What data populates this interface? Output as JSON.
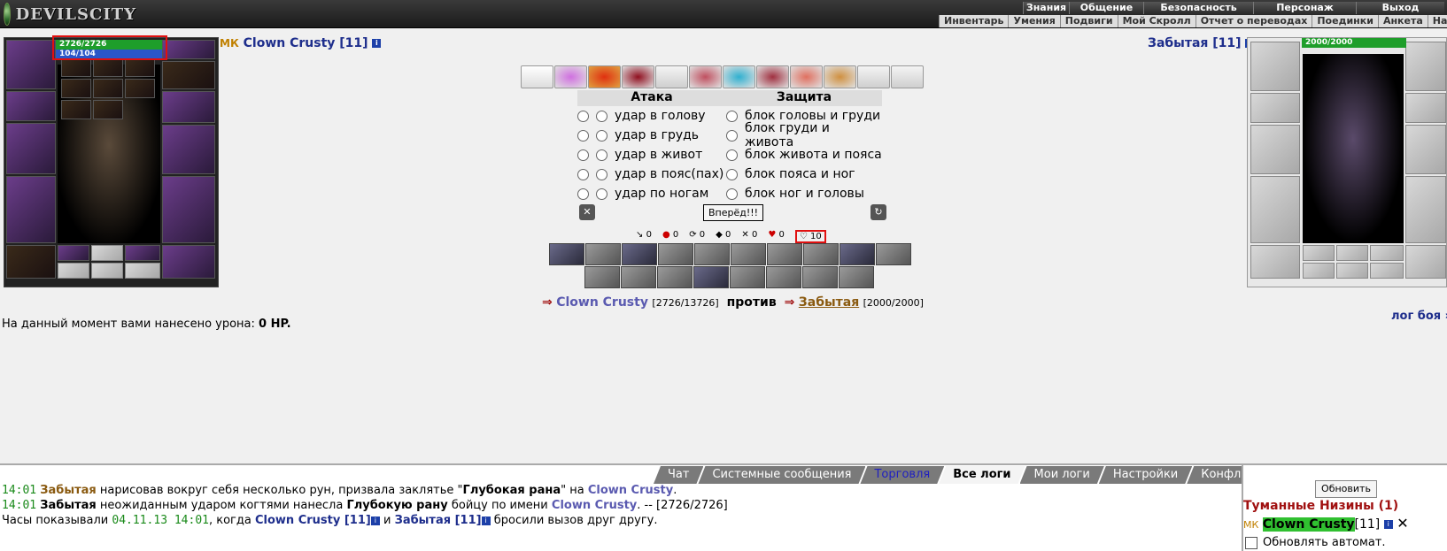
{
  "site": {
    "logo_text": "DEVILSCITY"
  },
  "main_menu": [
    "Знания",
    "Общение",
    "Безопасность",
    "Персонаж",
    "Выход"
  ],
  "sub_menu": [
    "Инвентарь",
    "Умения",
    "Подвиги",
    "Мой Скролл",
    "Отчет о переводах",
    "Поединки",
    "Анкета",
    "Настройки"
  ],
  "player": {
    "name": "Clown Crusty [11]",
    "hp": "2726/2726",
    "mana": "104/104",
    "clan_badge": "МК",
    "hp_fraction": 1.0,
    "mana_fraction": 1.0
  },
  "enemy": {
    "name": "Забытая [11]",
    "hp": "2000/2000",
    "hp_fraction": 1.0
  },
  "combat": {
    "attack_header": "Атака",
    "defense_header": "Защита",
    "attacks": [
      "удар в голову",
      "удар в грудь",
      "удар в живот",
      "удар в пояс(пах)",
      "удар по ногам"
    ],
    "blocks": [
      "блок головы и груди",
      "блок груди и живота",
      "блок живота и пояса",
      "блок пояса и ног",
      "блок ног и головы"
    ],
    "forward_button": "Вперёд!!!"
  },
  "counters": [
    "0",
    "0",
    "0",
    "0",
    "0",
    "0",
    "10"
  ],
  "versus": {
    "player_name": "Clown Crusty",
    "player_hp": "[2726/13726]",
    "vs_word": "против",
    "enemy_name": "Забытая",
    "enemy_hp": "[2000/2000]"
  },
  "damage_text": {
    "prefix": "На данный момент вами нанесено урона:",
    "value": "0 HP."
  },
  "battle_log_link": "лог боя »",
  "chat_tabs": [
    "Чат",
    "Системные сообщения",
    "Торговля",
    "Все логи",
    "Мои логи",
    "Настройки",
    "Конфликты"
  ],
  "chat_active_tab": "Все логи",
  "log_lines": [
    {
      "time": "14:01",
      "actor": "Забытая",
      "text1": "нарисовав вокруг себя несколько рун, призвала заклятье \"",
      "spell": "Глубокая рана",
      "text2": "\" на",
      "target": "Clown Crusty",
      "tail": "."
    },
    {
      "time": "14:01",
      "actor": "Забытая",
      "text1": "неожиданным ударом когтями нанесла",
      "spell": "Глубокую рану",
      "text2": "бойцу по имени",
      "target": "Clown Crusty",
      "tail": ". -- [2726/2726]"
    },
    {
      "prefix": "Часы показывали",
      "date": "04.11.13 14:01",
      "mid": ", когда",
      "p1": "Clown Crusty [11]",
      "and": "и",
      "p2": "Забытая [11]",
      "end": "бросили вызов друг другу."
    }
  ],
  "side": {
    "refresh_button": "Обновить",
    "location": "Туманные Низины (1)",
    "user_name": "Clown Crusty",
    "user_level": "[11]",
    "auto_refresh": "Обновлять автомат."
  }
}
